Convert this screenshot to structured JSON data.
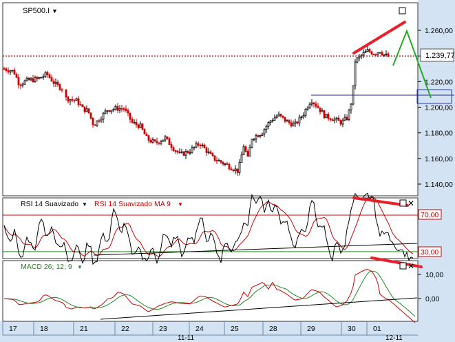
{
  "main_panel": {
    "symbol_label": "SP500.I",
    "last_price_badge": "1.239,77",
    "y_ticks": [
      {
        "label": "1.260,00",
        "value": 1260
      },
      {
        "label": "1.240,00",
        "value": 1240
      },
      {
        "label": "1.220,00",
        "value": 1220
      },
      {
        "label": "1.200,00",
        "value": 1200
      },
      {
        "label": "1.180,00",
        "value": 1180
      },
      {
        "label": "1.160,00",
        "value": 1160
      },
      {
        "label": "1.140,00",
        "value": 1140
      }
    ],
    "support_level": 1240
  },
  "rsi_panel": {
    "label_a": "RSI 14 Suavizado",
    "label_b": "RSI 14 Suavizado MA 9",
    "levels": [
      {
        "label": "70,00",
        "value": 70,
        "color": "#cc0000"
      },
      {
        "label": "30,00",
        "value": 30,
        "color": "#008800"
      }
    ]
  },
  "macd_panel": {
    "label": "MACD 26; 12; 9",
    "ticks": [
      {
        "label": "10,00",
        "value": 10
      },
      {
        "label": "0,00",
        "value": 0
      }
    ]
  },
  "time_axis": {
    "days": [
      "17",
      "18",
      "21",
      "22",
      "23",
      "24",
      "25",
      "28",
      "29",
      "30",
      "01"
    ],
    "months": [
      "11-11",
      "12-11"
    ]
  },
  "colors": {
    "up_candle": "#000000",
    "down_candle": "#cc0000",
    "annotation_red": "#e8202a",
    "annotation_green": "#22aa22",
    "rsi_line": "#000000",
    "rsi_ma": "#cc0000",
    "macd_line": "#cc0000",
    "signal_line": "#228822",
    "axis_bg": "#d4e3f3"
  }
}
